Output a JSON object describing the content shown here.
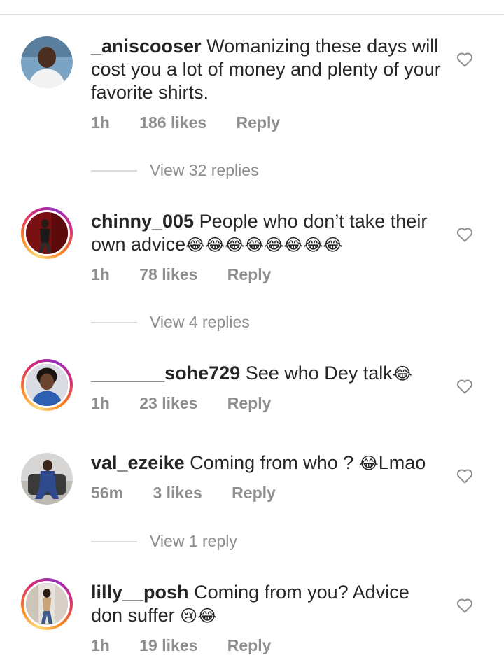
{
  "comments": [
    {
      "username": "_aniscooser",
      "text": "Womanizing these days will cost you a lot of money and plenty of your favorite shirts.",
      "emojis": "",
      "time": "1h",
      "likes": "186 likes",
      "reply": "Reply",
      "view_replies": "View 32 replies"
    },
    {
      "username": "chinny_005",
      "text": "People who don’t take their own advice",
      "emojis": "😂😂😂😂😂😂😂😂",
      "time": "1h",
      "likes": "78 likes",
      "reply": "Reply",
      "view_replies": "View 4 replies"
    },
    {
      "username": "_______sohe729",
      "text": "See who Dey talk",
      "emojis": "😂",
      "time": "1h",
      "likes": "23 likes",
      "reply": "Reply"
    },
    {
      "username": "val_ezeike",
      "text": "Coming from who ? ",
      "emojis": "😂",
      "text_after": "Lmao",
      "time": "56m",
      "likes": "3 likes",
      "reply": "Reply",
      "view_replies": "View 1 reply"
    },
    {
      "username": "lilly__posh",
      "text": "Coming from you? Advice don suffer ",
      "emojis": "😢😂",
      "time": "1h",
      "likes": "19 likes",
      "reply": "Reply"
    }
  ],
  "colors": {
    "text": "#262626",
    "secondary": "#8e8e8e",
    "story_ring": [
      "#feda75",
      "#fa7e1e",
      "#d62976",
      "#962fbf"
    ]
  },
  "icons": {
    "like": "heart-outline-icon"
  }
}
